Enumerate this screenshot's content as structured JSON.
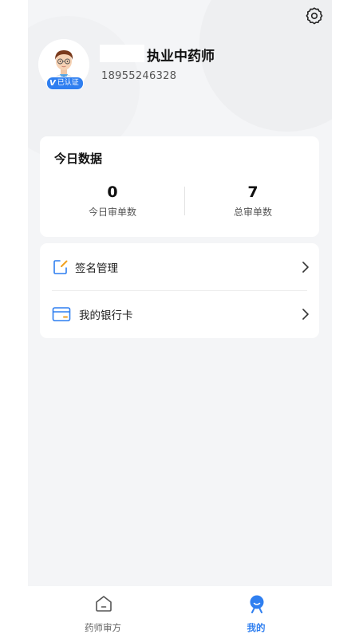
{
  "profile": {
    "title": "执业中药师",
    "phone": "18955246328",
    "verified_badge": "已认证",
    "avatar_icon": "pharmacist-avatar"
  },
  "header": {
    "settings_icon": "gear-icon"
  },
  "today_stats": {
    "title": "今日数据",
    "items": [
      {
        "value": "0",
        "label": "今日审单数"
      },
      {
        "value": "7",
        "label": "总审单数"
      }
    ]
  },
  "menu": {
    "items": [
      {
        "label": "签名管理",
        "icon": "edit-signature-icon"
      },
      {
        "label": "我的银行卡",
        "icon": "bank-card-icon"
      }
    ]
  },
  "tabbar": {
    "items": [
      {
        "label": "药师审方",
        "icon": "home-icon",
        "active": false
      },
      {
        "label": "我的",
        "icon": "profile-icon",
        "active": true
      }
    ]
  },
  "colors": {
    "accent": "#2f7ff0",
    "background": "#f4f5f7",
    "card": "#ffffff",
    "icon_orange": "#f0a020"
  }
}
